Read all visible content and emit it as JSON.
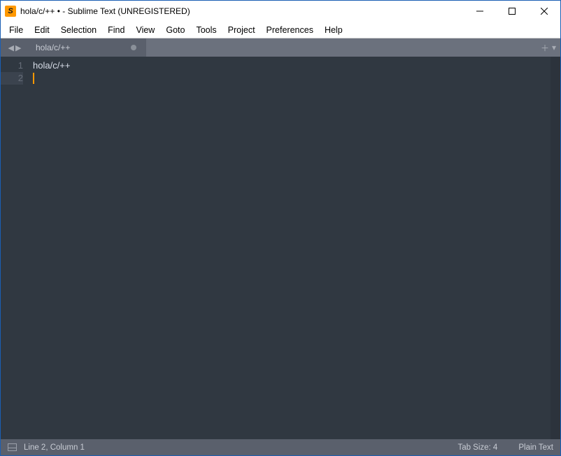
{
  "window": {
    "title": "hola/c/++ • - Sublime Text (UNREGISTERED)"
  },
  "menu": {
    "file": "File",
    "edit": "Edit",
    "selection": "Selection",
    "find": "Find",
    "view": "View",
    "goto": "Goto",
    "tools": "Tools",
    "project": "Project",
    "preferences": "Preferences",
    "help": "Help"
  },
  "tabs": {
    "active": {
      "label": "hola/c/++",
      "dirty": true
    }
  },
  "editor": {
    "lines": [
      "hola/c/++",
      ""
    ],
    "gutter": [
      "1",
      "2"
    ],
    "cursor_line_index": 1
  },
  "statusbar": {
    "position": "Line 2, Column 1",
    "tab_size": "Tab Size: 4",
    "syntax": "Plain Text"
  }
}
